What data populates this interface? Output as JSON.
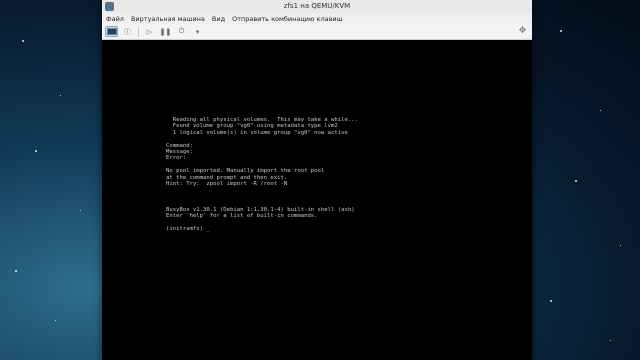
{
  "window": {
    "title": "zfs1 на QEMU/KVM"
  },
  "menu": {
    "items": [
      "Файл",
      "Виртуальная машина",
      "Вид",
      "Отправить комбинацию клавиш"
    ]
  },
  "toolbar": {
    "icons": [
      "console-view-icon",
      "power-icon",
      "play-icon",
      "pause-icon",
      "power-off-icon",
      "chevron-down-icon",
      "fullscreen-icon"
    ]
  },
  "console": {
    "lines": [
      "  Reading all physical volumes.  This may take a while...",
      "  Found volume group \"vg0\" using metadata type lvm2",
      "  1 logical volume(s) in volume group \"vg0\" now active",
      "",
      "Command:",
      "Message:",
      "Error:",
      "",
      "No pool imported. Manually import the root pool",
      "at the command prompt and then exit.",
      "Hint: Try:  zpool import -R /root -N",
      "",
      "",
      "",
      "BusyBox v1.30.1 (Debian 1:1.30.1-4) built-in shell (ash)",
      "Enter 'help' for a list of built-in commands.",
      "",
      "(initramfs) _"
    ]
  }
}
